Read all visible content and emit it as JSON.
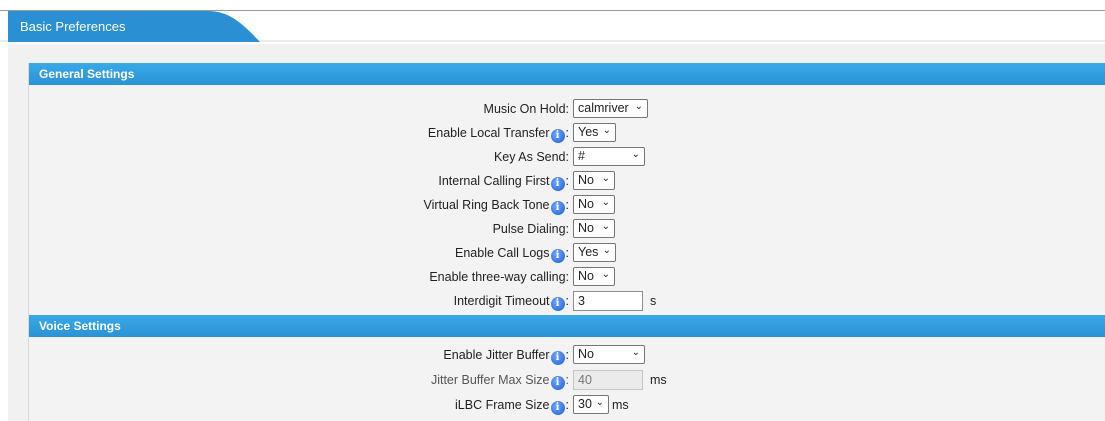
{
  "tabs": [
    {
      "label": "Basic Preferences"
    }
  ],
  "colors": {
    "accent": "#2a93d6",
    "tab": "#2b8fd4"
  },
  "sections": {
    "general": {
      "title": "General Settings",
      "fields": {
        "music_on_hold": {
          "label": "Music On Hold:",
          "value": "calmriver"
        },
        "enable_local_transfer": {
          "label": "Enable Local Transfer",
          "value": "Yes"
        },
        "key_as_send": {
          "label": "Key As Send:",
          "value": "#"
        },
        "internal_calling_first": {
          "label": "Internal Calling First",
          "value": "No"
        },
        "virtual_ring_back_tone": {
          "label": "Virtual Ring Back Tone",
          "value": "No"
        },
        "pulse_dialing": {
          "label": "Pulse Dialing:",
          "value": "No"
        },
        "enable_call_logs": {
          "label": "Enable Call Logs",
          "value": "Yes"
        },
        "enable_three_way_calling": {
          "label": "Enable three-way calling:",
          "value": "No"
        },
        "interdigit_timeout": {
          "label": "Interdigit Timeout",
          "value": "3",
          "unit": "s"
        }
      }
    },
    "voice": {
      "title": "Voice Settings",
      "fields": {
        "enable_jitter_buffer": {
          "label": "Enable Jitter Buffer",
          "value": "No"
        },
        "jitter_buffer_max_size": {
          "label": "Jitter Buffer Max Size",
          "value": "40",
          "unit": "ms"
        },
        "ilbc_frame_size": {
          "label": "iLBC Frame Size",
          "value": "30",
          "unit": "ms"
        }
      }
    }
  },
  "icons": {
    "info": "info-icon",
    "dropdown": "chevron-down-icon"
  }
}
